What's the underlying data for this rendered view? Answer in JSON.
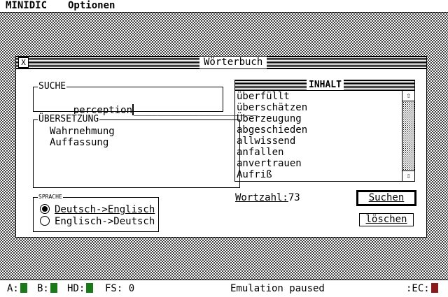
{
  "menubar": {
    "items": [
      "MINIDIC",
      "Optionen"
    ]
  },
  "window": {
    "title": "Wörterbuch",
    "close_glyph": "X",
    "search": {
      "label": "SUCHE",
      "value": "perception",
      "underscores": "_____________________"
    },
    "translation": {
      "label": "ÜBERSETZUNG",
      "lines": [
        "Wahrnehmung",
        "Auffassung"
      ]
    },
    "language": {
      "label": "SPRACHE",
      "options": [
        {
          "label": "Deutsch->Englisch",
          "selected": true
        },
        {
          "label": "Englisch->Deutsch",
          "selected": false
        }
      ]
    },
    "contents": {
      "label": "INHALT",
      "items": [
        "überfüllt",
        "überschätzen",
        "Überzeugung",
        "abgeschieden",
        "allwissend",
        "anfallen",
        "anvertrauen",
        "Aufriß"
      ],
      "up_arrow": "⇧",
      "down_arrow": "⇩"
    },
    "word_count_label": "Wortzahl:",
    "word_count_value": "73",
    "buttons": {
      "search": "Suchen",
      "delete": "löschen"
    }
  },
  "statusbar": {
    "a_label": "A:",
    "b_label": "B:",
    "hd_label": "HD:",
    "fs_label": "FS:",
    "fs_value": "0",
    "message": "Emulation paused",
    "ec_label": ":EC:",
    "led_colors": {
      "green": "#1a7a1a",
      "red": "#8b1a1a"
    }
  }
}
